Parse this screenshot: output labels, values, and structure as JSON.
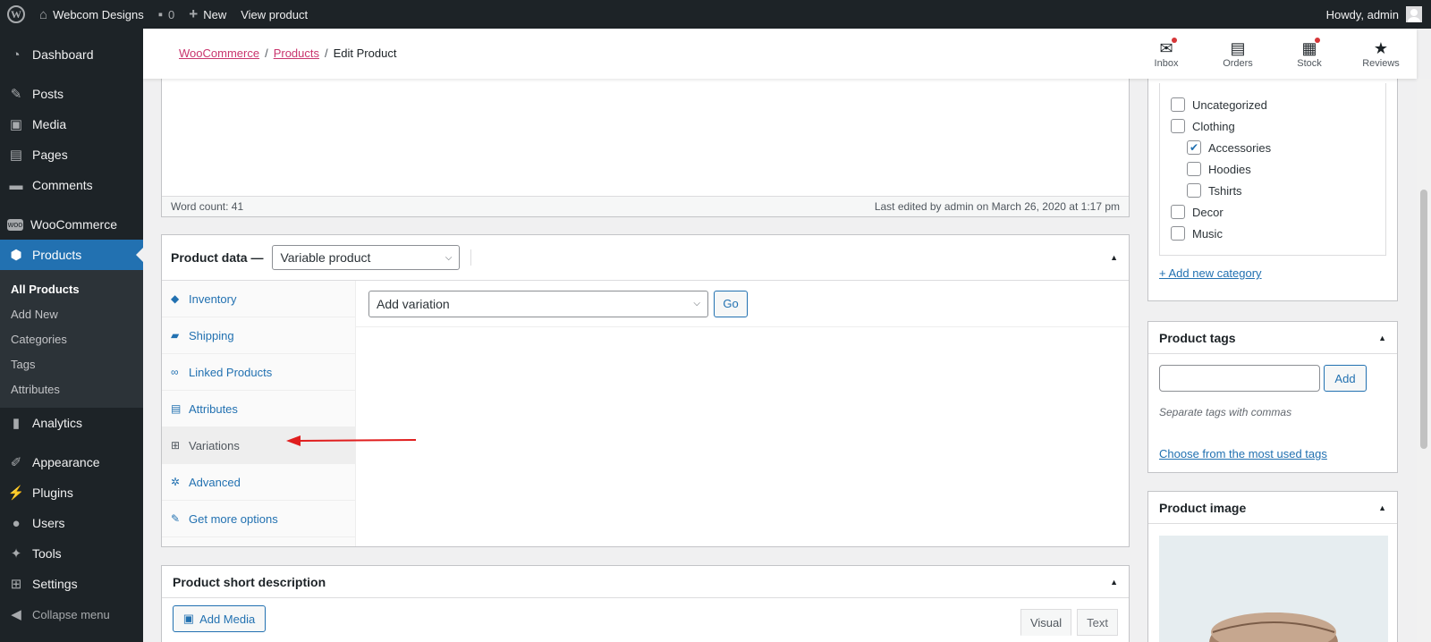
{
  "adminbar": {
    "site_name": "Webcom Designs",
    "comments_count": "0",
    "new_label": "New",
    "view_product": "View product",
    "howdy": "Howdy, admin"
  },
  "sidebar": {
    "dashboard": "Dashboard",
    "posts": "Posts",
    "media": "Media",
    "pages": "Pages",
    "comments": "Comments",
    "woocommerce": "WooCommerce",
    "products": "Products",
    "submenu": [
      "All Products",
      "Add New",
      "Categories",
      "Tags",
      "Attributes"
    ],
    "analytics": "Analytics",
    "appearance": "Appearance",
    "plugins": "Plugins",
    "users": "Users",
    "tools": "Tools",
    "settings": "Settings",
    "collapse": "Collapse menu"
  },
  "wc_header": {
    "breadcrumb": [
      "WooCommerce",
      "Products",
      "Edit Product"
    ],
    "actions": [
      "Inbox",
      "Orders",
      "Stock",
      "Reviews"
    ]
  },
  "editor": {
    "word_count": "Word count: 41",
    "last_edited": "Last edited by admin on March 26, 2020 at 1:17 pm"
  },
  "product_data": {
    "title": "Product data —",
    "type": "Variable product",
    "tabs": [
      "Inventory",
      "Shipping",
      "Linked Products",
      "Attributes",
      "Variations",
      "Advanced",
      "Get more options"
    ],
    "variation_select": "Add variation",
    "go_label": "Go"
  },
  "short_description": {
    "title": "Product short description",
    "add_media": "Add Media",
    "tab_visual": "Visual",
    "tab_text": "Text"
  },
  "categories": {
    "items": [
      "Uncategorized",
      "Clothing",
      "Accessories",
      "Hoodies",
      "Tshirts",
      "Decor",
      "Music"
    ],
    "checked": [
      false,
      false,
      true,
      false,
      false,
      false,
      false
    ],
    "add_new": "+ Add new category"
  },
  "tags": {
    "title": "Product tags",
    "input_value": "",
    "add_label": "Add",
    "hint": "Separate tags with commas",
    "most_used": "Choose from the most used tags"
  },
  "product_image": {
    "title": "Product image"
  },
  "colors": {
    "admin_dark": "#1d2327",
    "accent": "#2271b1",
    "woo_link": "#c9356e",
    "annotation_arrow": "#e01e1e"
  }
}
